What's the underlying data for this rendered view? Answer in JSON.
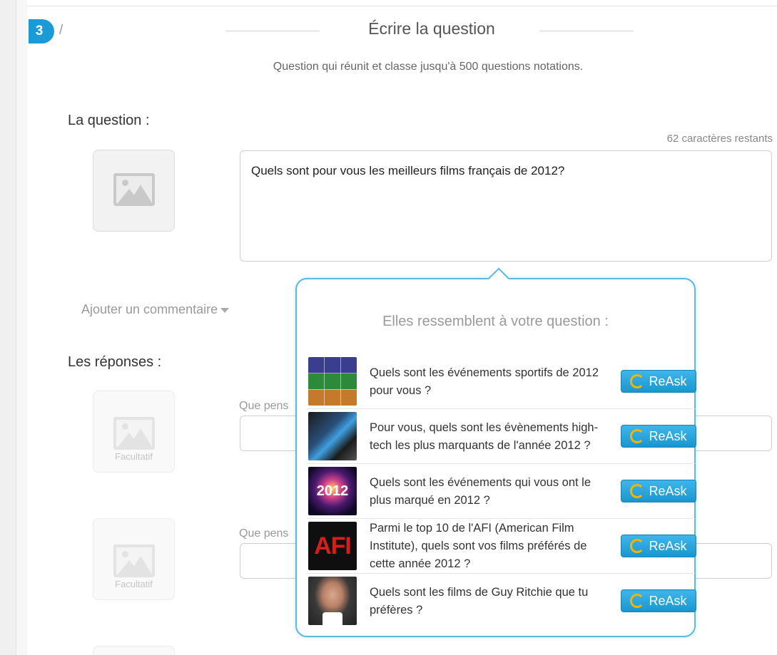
{
  "step": {
    "number": "3",
    "separator": "/",
    "title": "Écrire la question",
    "subtitle": "Question qui réunit et classe jusqu'à 500 questions notations."
  },
  "question": {
    "label": "La question :",
    "chars_remaining": "62 caractères restants",
    "value": "Quels sont pour vous les meilleurs films français de 2012?",
    "image_icon": "image-placeholder-icon"
  },
  "comment_link": "Ajouter un commentaire",
  "answers": {
    "label": "Les réponses :",
    "image_caption": "Facultatif",
    "placeholder_visible": "Que pens"
  },
  "suggestions": {
    "title": "Elles ressemblent à votre question :",
    "button_label": "ReAsk",
    "items": [
      {
        "text": "Quels sont les événements sportifs de 2012 pour vous ?"
      },
      {
        "text": "Pour vous, quels sont les évènements high-tech les plus marquants de l'année 2012 ?"
      },
      {
        "text": "Quels sont les événements qui vous ont le plus marqué en 2012 ?",
        "thumb_text": "2012"
      },
      {
        "text": "Parmi le top 10 de l'AFI (American Film Institute), quels sont vos films préférés de cette année 2012 ?",
        "thumb_text": "AFI"
      },
      {
        "text": "Quels sont les films de Guy Ritchie que tu préfères ?"
      }
    ]
  },
  "colors": {
    "accent": "#1a9ad6",
    "popup_border": "#5ab8e3",
    "reask_icon": "#f4b400"
  }
}
